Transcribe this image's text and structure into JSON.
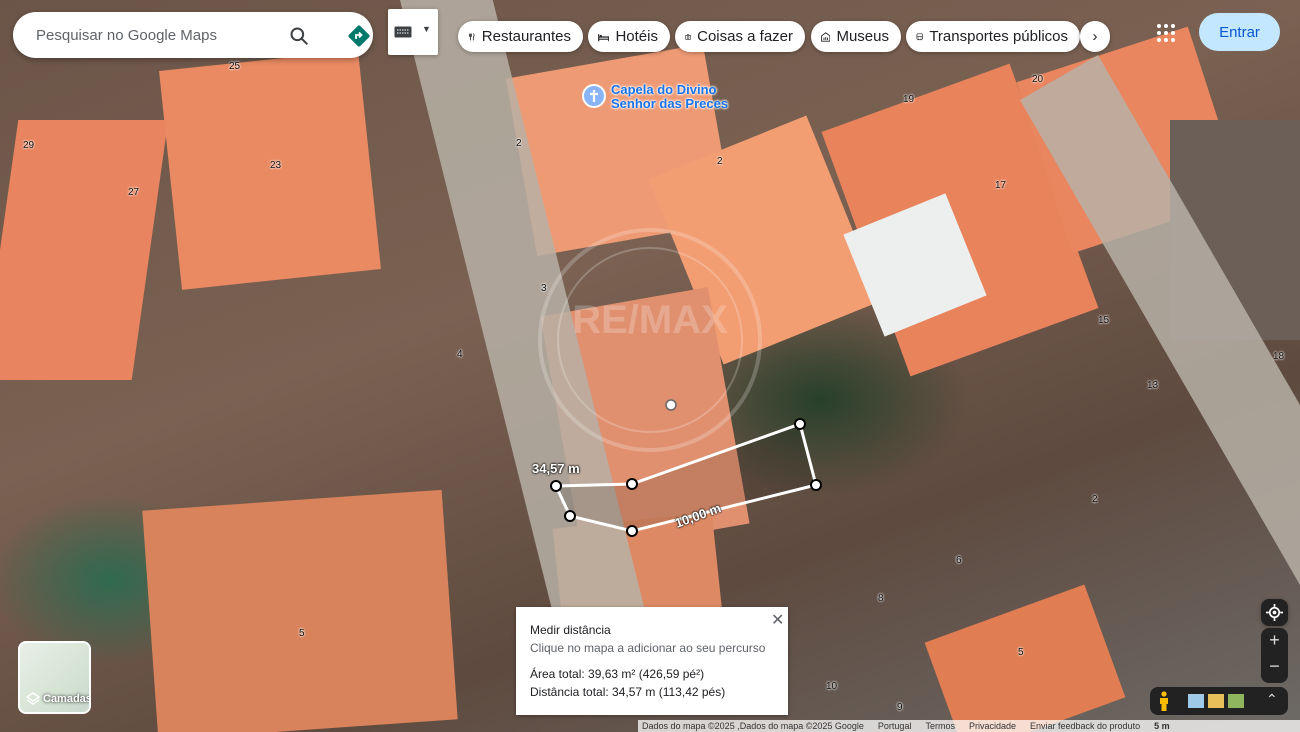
{
  "search": {
    "placeholder": "Pesquisar no Google Maps"
  },
  "chips": [
    {
      "label": "Restaurantes",
      "icon": "restaurant-icon"
    },
    {
      "label": "Hotéis",
      "icon": "bed-icon"
    },
    {
      "label": "Coisas a fazer",
      "icon": "camera-icon"
    },
    {
      "label": "Museus",
      "icon": "museum-icon"
    },
    {
      "label": "Transportes públicos",
      "icon": "transit-icon"
    }
  ],
  "signin_label": "Entrar",
  "poi": {
    "name": "Capela do Divino Senhor das Preces",
    "icon": "cross-icon"
  },
  "house_numbers": [
    "25",
    "29",
    "23",
    "27",
    "2",
    "2",
    "19",
    "20",
    "17",
    "3",
    "4",
    "15",
    "18",
    "13",
    "2",
    "6",
    "8",
    "5",
    "5",
    "10",
    "9"
  ],
  "watermark": "RE/MAX",
  "measure": {
    "segment_label_1": "34,57 m",
    "segment_label_2": "10,00 m"
  },
  "panel": {
    "title": "Medir distância",
    "subtitle": "Clique no mapa a adicionar ao seu percurso",
    "area": "Área total: 39,63 m² (426,59 pé²)",
    "distance": "Distância total: 34,57 m (113,42 pés)",
    "close_icon": "close-icon"
  },
  "layers_label": "Camadas",
  "zoom": {
    "in": "+",
    "out": "−"
  },
  "footer": {
    "attribution": "Dados do mapa ©2025 ,Dados do mapa ©2025 Google",
    "region": "Portugal",
    "terms": "Termos",
    "privacy": "Privacidade",
    "feedback": "Enviar feedback do produto",
    "scale": "5 m"
  },
  "colors": {
    "accent": "#0b57d0",
    "signin_bg": "#c2e7ff",
    "directions": "#00796b",
    "poi": "#1a73e8"
  }
}
